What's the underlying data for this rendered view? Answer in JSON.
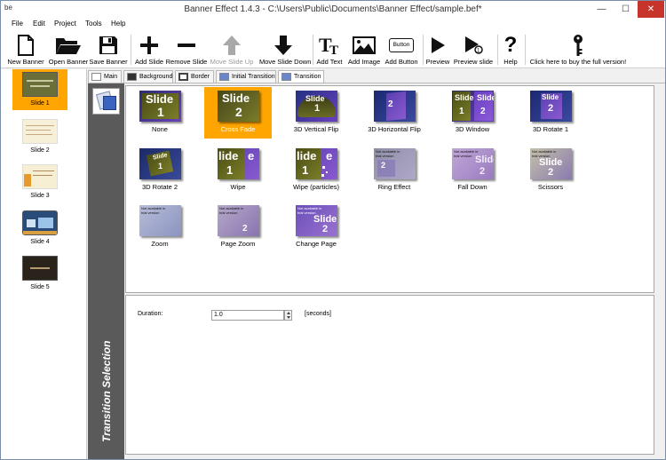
{
  "window": {
    "title": "Banner Effect 1.4.3 -  C:\\Users\\Public\\Documents\\Banner Effect/sample.bef*",
    "app_icon": "be",
    "controls": [
      "minimize-icon",
      "maximize-icon",
      "close-icon"
    ]
  },
  "menu": [
    "File",
    "Edit",
    "Project",
    "Tools",
    "Help"
  ],
  "toolbar": {
    "new_banner": "New Banner",
    "open_banner": "Open Banner",
    "save_banner": "Save Banner",
    "add_slide": "Add Slide",
    "remove_slide": "Remove Slide",
    "move_slide_up": "Move Slide Up",
    "move_slide_down": "Move Slide Down",
    "add_text": "Add Text",
    "add_image": "Add Image",
    "add_button": "Add Button",
    "add_button_icon_text": "Button",
    "preview": "Preview",
    "preview_slide": "Preview slide",
    "help": "Help",
    "buy": "Click here to buy the full version!"
  },
  "slides": [
    {
      "label": "Slide 1",
      "selected": true
    },
    {
      "label": "Slide 2",
      "selected": false
    },
    {
      "label": "Slide 3",
      "selected": false
    },
    {
      "label": "Slide 4",
      "selected": false
    },
    {
      "label": "Slide 5",
      "selected": false
    }
  ],
  "tabs": [
    "Main",
    "Background",
    "Border",
    "Initial Transition",
    "Transition"
  ],
  "active_tab": "Transition",
  "side_title": "Transition Selection",
  "thumb": {
    "slide_word": "Slide",
    "n1": "1",
    "n2": "2",
    "trial_note": "Not available in trial version",
    "lide": "lide",
    "e": "e"
  },
  "transitions": [
    {
      "label": "None"
    },
    {
      "label": "Cross Fade",
      "selected": true
    },
    {
      "label": "3D Vertical Flip"
    },
    {
      "label": "3D Horizontal Flip"
    },
    {
      "label": "3D Window"
    },
    {
      "label": "3D Rotate 1"
    },
    {
      "label": "3D Rotate 2"
    },
    {
      "label": "Wipe"
    },
    {
      "label": "Wipe (particles)"
    },
    {
      "label": "Ring Effect"
    },
    {
      "label": "Fall Down"
    },
    {
      "label": "Scissors"
    },
    {
      "label": "Zoom"
    },
    {
      "label": "Page Zoom"
    },
    {
      "label": "Change Page"
    }
  ],
  "duration": {
    "label": "Duration:",
    "value": "1.0",
    "unit": "[seconds]"
  },
  "colors": {
    "selection": "#ffa500",
    "close_button": "#c7342b",
    "side_strip": "#5a5a5a",
    "slide_green": "#565a1c",
    "slide_purple": "#7a3fc2",
    "slide_blue": "#23317a"
  }
}
